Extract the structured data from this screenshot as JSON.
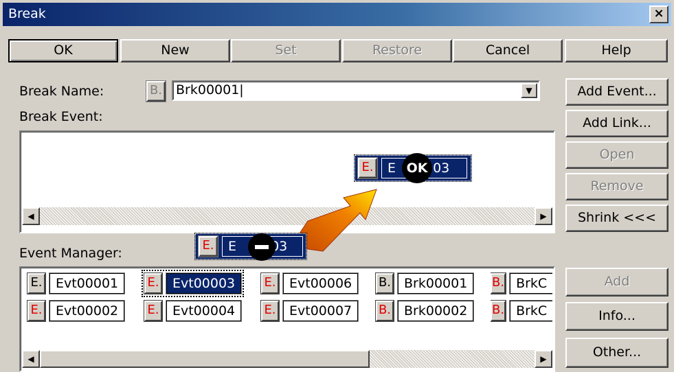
{
  "window": {
    "title": "Break",
    "close": "×"
  },
  "toolbar": {
    "ok": "OK",
    "new": "New",
    "set": "Set",
    "restore": "Restore",
    "cancel": "Cancel",
    "help": "Help"
  },
  "break_name": {
    "label": "Break Name:",
    "icon": "B.",
    "value": "Brk00001|"
  },
  "break_event": {
    "label": "Break Event:"
  },
  "drag_target": {
    "tag": "E.",
    "text": "E",
    "suffix": "003",
    "badge": "OK"
  },
  "drag_source": {
    "tag": "E.",
    "text": "E",
    "suffix": "003"
  },
  "side_buttons": {
    "add_event": "Add Event...",
    "add_link": "Add Link...",
    "open": "Open",
    "remove": "Remove",
    "shrink": "Shrink <<<",
    "add": "Add",
    "info": "Info...",
    "other": "Other..."
  },
  "event_manager": {
    "label": "Event Manager:",
    "row1": [
      {
        "tag": "E.",
        "name": "Evt00001"
      },
      {
        "tag": "E.",
        "name": "Evt00003"
      },
      {
        "tag": "E.",
        "name": "Evt00006"
      },
      {
        "tag": "B.",
        "name": "Brk00001"
      },
      {
        "tag": "B.",
        "name": "BrkC"
      }
    ],
    "row2": [
      {
        "tag": "E.",
        "name": "Evt00002"
      },
      {
        "tag": "E.",
        "name": "Evt00004"
      },
      {
        "tag": "E.",
        "name": "Evt00007"
      },
      {
        "tag": "B.",
        "name": "Brk00002"
      },
      {
        "tag": "B.",
        "name": "BrkC"
      }
    ]
  },
  "scroll": {
    "left": "◀",
    "right": "▶",
    "down": "▼"
  },
  "colors": {
    "selection": "#0a246a",
    "event_tag": "#e00000",
    "face": "#d4d0c8"
  },
  "icons": [
    "close-icon",
    "combo-arrow-icon",
    "drag-arrow-icon",
    "ok-badge-icon",
    "no-drop-icon"
  ]
}
